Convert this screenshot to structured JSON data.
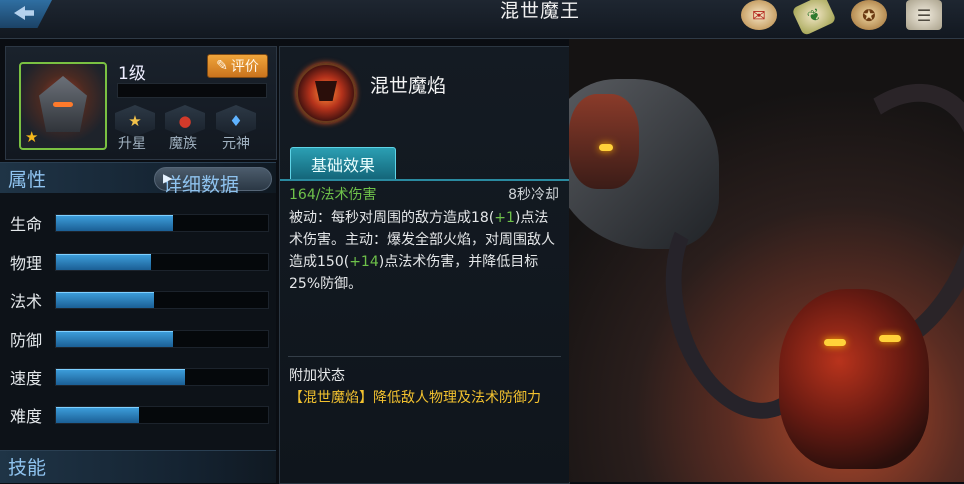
{
  "header": {
    "title": "混世魔王",
    "icons": [
      "scroll-seal-icon",
      "scroll-green-icon",
      "coin-icon",
      "document-icon"
    ]
  },
  "hero": {
    "level": "1级",
    "rate_label": "评价",
    "stars": 1,
    "badges": [
      "升星",
      "魔族",
      "元神"
    ]
  },
  "attributes": {
    "title": "属性",
    "detail_label": "详细数据",
    "items": [
      {
        "name": "生命",
        "level": 0.55
      },
      {
        "name": "物理",
        "level": 0.45
      },
      {
        "name": "法术",
        "level": 0.46
      },
      {
        "name": "防御",
        "level": 0.55
      },
      {
        "name": "速度",
        "level": 0.61
      },
      {
        "name": "难度",
        "level": 0.39
      }
    ]
  },
  "skills_title": "技能",
  "skill": {
    "name": "混世魔焰",
    "tab_label": "基础效果",
    "damage": "164/法术伤害",
    "cooldown": "8秒冷却",
    "desc_1": "被动：每秒对周围的敌方造成18(",
    "desc_plus_1": "+1",
    "desc_2": ")点法术伤害。主动：爆发全部火焰，对周围敌人造成150(",
    "desc_plus_2": "+14",
    "desc_3": ")点法术伤害，并降低目标25%防御。",
    "extra_label": "附加状态",
    "extra_text": "【混世魔焰】降低敌人物理及法术防御力"
  },
  "colors": {
    "bar": "#2b86c6",
    "tab": "#1f8aa0",
    "highlight_text": "#f2c12f",
    "green_text": "#6ec14a"
  }
}
